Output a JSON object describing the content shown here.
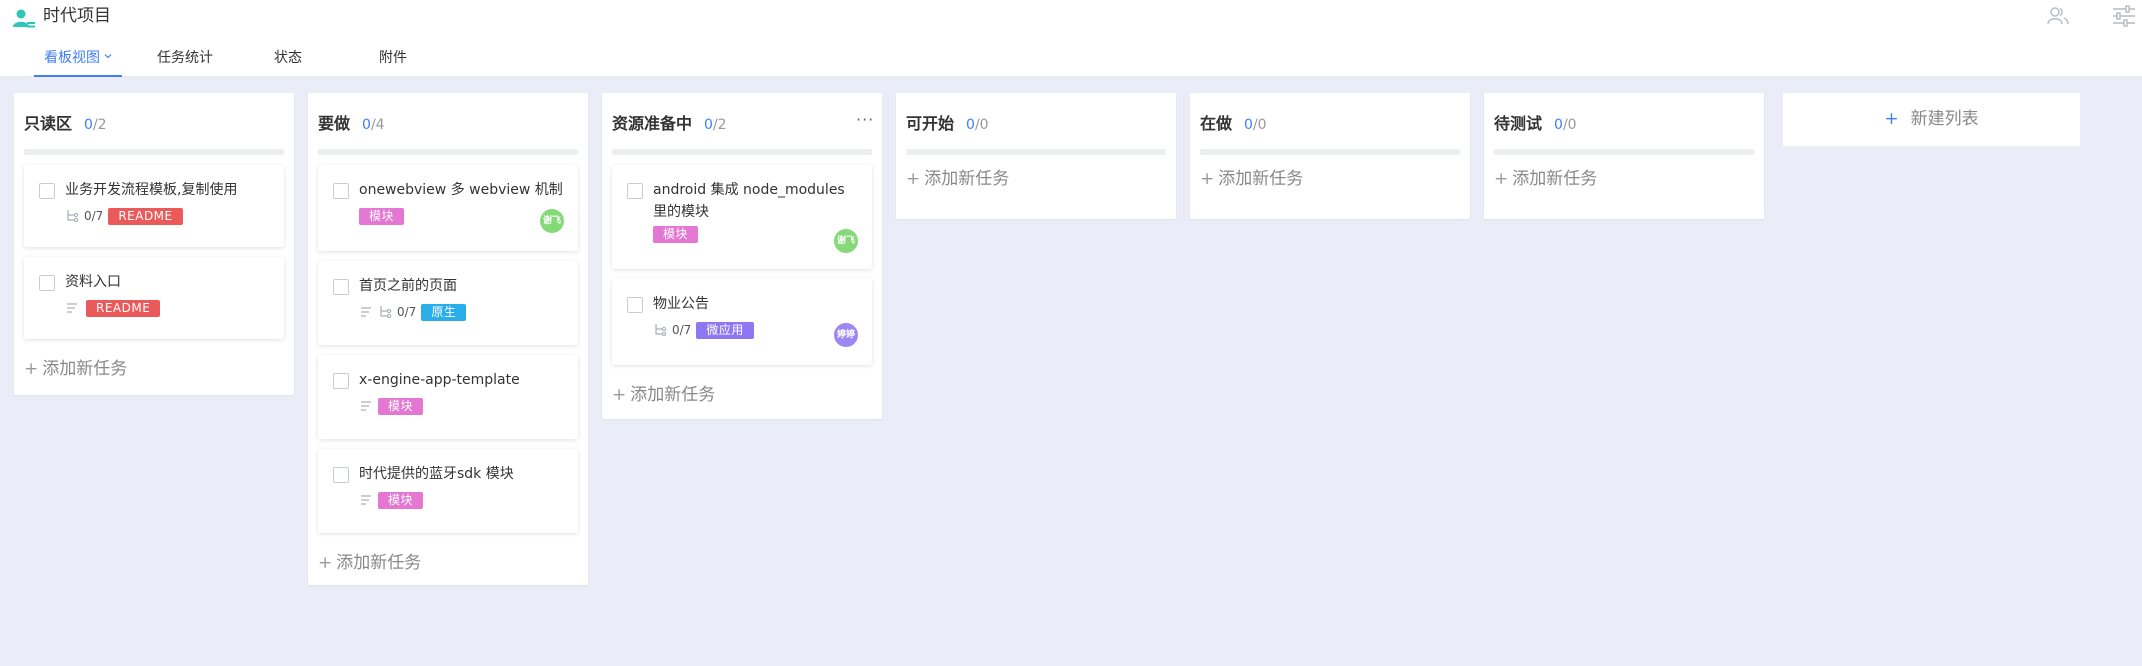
{
  "project": {
    "title": "时代项目"
  },
  "tabs": [
    {
      "label": "看板视图",
      "active": true
    },
    {
      "label": "任务统计"
    },
    {
      "label": "状态"
    },
    {
      "label": "附件"
    }
  ],
  "add_task_label": "添加新任务",
  "new_list_label": "新建列表",
  "colors": {
    "accent": "#3f7ef6",
    "readme": "#ea5a5a",
    "module": "#e377d2",
    "native": "#2aaee9",
    "microapp": "#8e77f0",
    "avatar_green": "#86d978",
    "avatar_purple": "#9c86f2"
  },
  "columns": [
    {
      "title": "只读区",
      "done": "0",
      "total": "/2",
      "cards": [
        {
          "title": "业务开发流程模板,复制使用",
          "subtask_count": "0/7",
          "tag": "README",
          "tag_color": "#ea5a5a",
          "has_desc": false
        },
        {
          "title": "资料入口",
          "tag": "README",
          "tag_color": "#ea5a5a",
          "has_desc": true
        }
      ]
    },
    {
      "title": "要做",
      "done": "0",
      "total": "/4",
      "cards": [
        {
          "title": "onewebview 多 webview 机制",
          "tag": "模块",
          "tag_color": "#e377d2",
          "avatar": "谢飞",
          "avatar_color": "#86d978"
        },
        {
          "title": "首页之前的页面",
          "subtask_count": "0/7",
          "tag": "原生",
          "tag_color": "#2aaee9",
          "has_desc": true
        },
        {
          "title": "x-engine-app-template",
          "tag": "模块",
          "tag_color": "#e377d2",
          "has_desc": true
        },
        {
          "title": "时代提供的蓝牙sdk 模块",
          "tag": "模块",
          "tag_color": "#e377d2",
          "has_desc": true
        }
      ]
    },
    {
      "title": "资源准备中",
      "done": "0",
      "total": "/2",
      "more": "···",
      "cards": [
        {
          "title": "android 集成 node_modules 里的模块",
          "tag": "模块",
          "tag_color": "#e377d2",
          "avatar": "谢飞",
          "avatar_color": "#86d978"
        },
        {
          "title": "物业公告",
          "subtask_count": "0/7",
          "tag": "微应用",
          "tag_color": "#8e77f0",
          "avatar": "婷婷",
          "avatar_color": "#9c86f2"
        }
      ]
    },
    {
      "title": "可开始",
      "done": "0",
      "total": "/0",
      "cards": []
    },
    {
      "title": "在做",
      "done": "0",
      "total": "/0",
      "cards": []
    },
    {
      "title": "待测试",
      "done": "0",
      "total": "/0",
      "cards": []
    }
  ]
}
